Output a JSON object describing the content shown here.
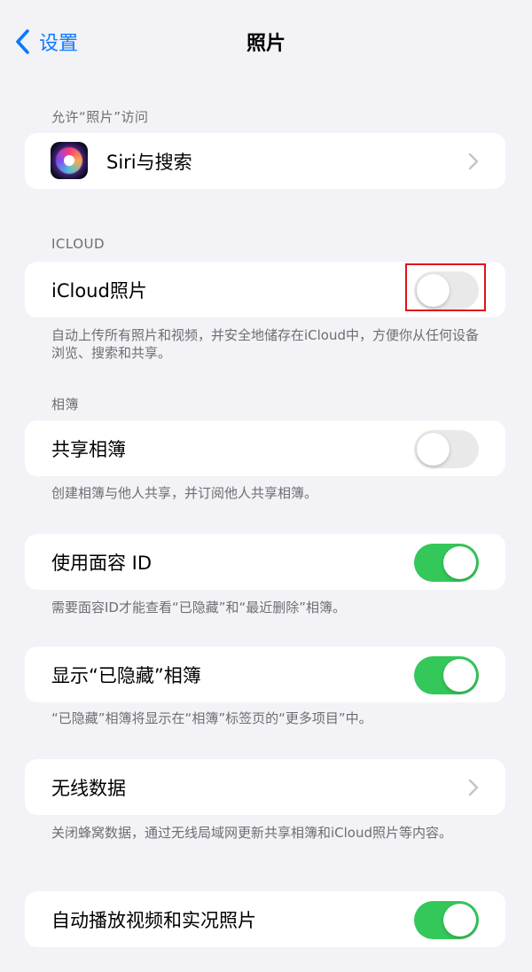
{
  "nav": {
    "back_label": "设置",
    "title": "照片"
  },
  "sections": {
    "access": {
      "header": "允许“照片”访问",
      "siri_label": "Siri与搜索"
    },
    "icloud": {
      "header": "ICLOUD",
      "icloud_photos_label": "iCloud照片",
      "icloud_photos_on": false,
      "footer": "自动上传所有照片和视频，并安全地储存在iCloud中，方便你从任何设备浏览、搜索和共享。"
    },
    "albums": {
      "header": "相簿",
      "shared_albums_label": "共享相簿",
      "shared_albums_on": false,
      "footer": "创建相簿与他人共享，并订阅他人共享相簿。"
    },
    "faceid": {
      "label": "使用面容 ID",
      "on": true,
      "footer": "需要面容ID才能查看“已隐藏”和“最近删除”相簿。"
    },
    "hidden": {
      "label": "显示“已隐藏”相簿",
      "on": true,
      "footer": "“已隐藏”相簿将显示在“相簿”标签页的“更多项目”中。"
    },
    "wireless": {
      "label": "无线数据",
      "footer": "关闭蜂窝数据，通过无线局域网更新共享相簿和iCloud照片等内容。"
    },
    "autoplay": {
      "label": "自动播放视频和实况照片",
      "on": true
    }
  },
  "colors": {
    "accent": "#0a7aff",
    "toggle_on": "#34c759",
    "toggle_off": "#e9e9ea",
    "highlight": "#e0121c"
  },
  "icons": {
    "back": "chevron-left-icon",
    "siri": "siri-icon",
    "disclosure": "chevron-right-icon"
  }
}
